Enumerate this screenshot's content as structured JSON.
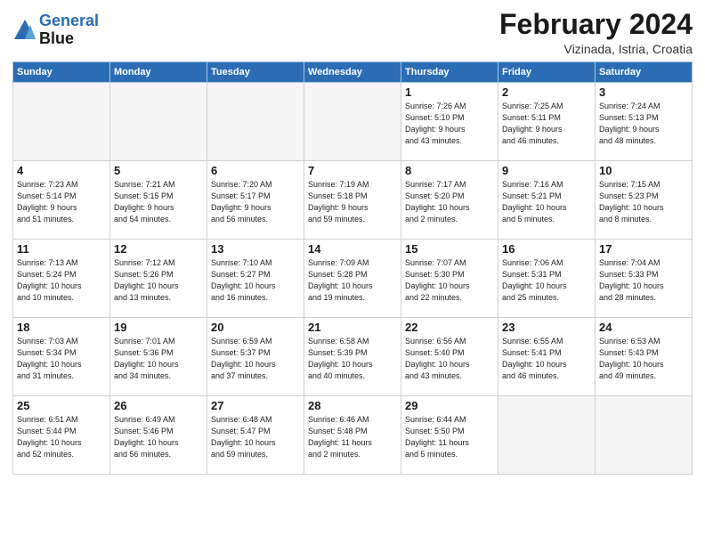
{
  "header": {
    "logo_line1": "General",
    "logo_line2": "Blue",
    "month_year": "February 2024",
    "location": "Vizinada, Istria, Croatia"
  },
  "days_of_week": [
    "Sunday",
    "Monday",
    "Tuesday",
    "Wednesday",
    "Thursday",
    "Friday",
    "Saturday"
  ],
  "weeks": [
    [
      {
        "num": "",
        "info": ""
      },
      {
        "num": "",
        "info": ""
      },
      {
        "num": "",
        "info": ""
      },
      {
        "num": "",
        "info": ""
      },
      {
        "num": "1",
        "info": "Sunrise: 7:26 AM\nSunset: 5:10 PM\nDaylight: 9 hours\nand 43 minutes."
      },
      {
        "num": "2",
        "info": "Sunrise: 7:25 AM\nSunset: 5:11 PM\nDaylight: 9 hours\nand 46 minutes."
      },
      {
        "num": "3",
        "info": "Sunrise: 7:24 AM\nSunset: 5:13 PM\nDaylight: 9 hours\nand 48 minutes."
      }
    ],
    [
      {
        "num": "4",
        "info": "Sunrise: 7:23 AM\nSunset: 5:14 PM\nDaylight: 9 hours\nand 51 minutes."
      },
      {
        "num": "5",
        "info": "Sunrise: 7:21 AM\nSunset: 5:15 PM\nDaylight: 9 hours\nand 54 minutes."
      },
      {
        "num": "6",
        "info": "Sunrise: 7:20 AM\nSunset: 5:17 PM\nDaylight: 9 hours\nand 56 minutes."
      },
      {
        "num": "7",
        "info": "Sunrise: 7:19 AM\nSunset: 5:18 PM\nDaylight: 9 hours\nand 59 minutes."
      },
      {
        "num": "8",
        "info": "Sunrise: 7:17 AM\nSunset: 5:20 PM\nDaylight: 10 hours\nand 2 minutes."
      },
      {
        "num": "9",
        "info": "Sunrise: 7:16 AM\nSunset: 5:21 PM\nDaylight: 10 hours\nand 5 minutes."
      },
      {
        "num": "10",
        "info": "Sunrise: 7:15 AM\nSunset: 5:23 PM\nDaylight: 10 hours\nand 8 minutes."
      }
    ],
    [
      {
        "num": "11",
        "info": "Sunrise: 7:13 AM\nSunset: 5:24 PM\nDaylight: 10 hours\nand 10 minutes."
      },
      {
        "num": "12",
        "info": "Sunrise: 7:12 AM\nSunset: 5:26 PM\nDaylight: 10 hours\nand 13 minutes."
      },
      {
        "num": "13",
        "info": "Sunrise: 7:10 AM\nSunset: 5:27 PM\nDaylight: 10 hours\nand 16 minutes."
      },
      {
        "num": "14",
        "info": "Sunrise: 7:09 AM\nSunset: 5:28 PM\nDaylight: 10 hours\nand 19 minutes."
      },
      {
        "num": "15",
        "info": "Sunrise: 7:07 AM\nSunset: 5:30 PM\nDaylight: 10 hours\nand 22 minutes."
      },
      {
        "num": "16",
        "info": "Sunrise: 7:06 AM\nSunset: 5:31 PM\nDaylight: 10 hours\nand 25 minutes."
      },
      {
        "num": "17",
        "info": "Sunrise: 7:04 AM\nSunset: 5:33 PM\nDaylight: 10 hours\nand 28 minutes."
      }
    ],
    [
      {
        "num": "18",
        "info": "Sunrise: 7:03 AM\nSunset: 5:34 PM\nDaylight: 10 hours\nand 31 minutes."
      },
      {
        "num": "19",
        "info": "Sunrise: 7:01 AM\nSunset: 5:36 PM\nDaylight: 10 hours\nand 34 minutes."
      },
      {
        "num": "20",
        "info": "Sunrise: 6:59 AM\nSunset: 5:37 PM\nDaylight: 10 hours\nand 37 minutes."
      },
      {
        "num": "21",
        "info": "Sunrise: 6:58 AM\nSunset: 5:39 PM\nDaylight: 10 hours\nand 40 minutes."
      },
      {
        "num": "22",
        "info": "Sunrise: 6:56 AM\nSunset: 5:40 PM\nDaylight: 10 hours\nand 43 minutes."
      },
      {
        "num": "23",
        "info": "Sunrise: 6:55 AM\nSunset: 5:41 PM\nDaylight: 10 hours\nand 46 minutes."
      },
      {
        "num": "24",
        "info": "Sunrise: 6:53 AM\nSunset: 5:43 PM\nDaylight: 10 hours\nand 49 minutes."
      }
    ],
    [
      {
        "num": "25",
        "info": "Sunrise: 6:51 AM\nSunset: 5:44 PM\nDaylight: 10 hours\nand 52 minutes."
      },
      {
        "num": "26",
        "info": "Sunrise: 6:49 AM\nSunset: 5:46 PM\nDaylight: 10 hours\nand 56 minutes."
      },
      {
        "num": "27",
        "info": "Sunrise: 6:48 AM\nSunset: 5:47 PM\nDaylight: 10 hours\nand 59 minutes."
      },
      {
        "num": "28",
        "info": "Sunrise: 6:46 AM\nSunset: 5:48 PM\nDaylight: 11 hours\nand 2 minutes."
      },
      {
        "num": "29",
        "info": "Sunrise: 6:44 AM\nSunset: 5:50 PM\nDaylight: 11 hours\nand 5 minutes."
      },
      {
        "num": "",
        "info": ""
      },
      {
        "num": "",
        "info": ""
      }
    ]
  ]
}
